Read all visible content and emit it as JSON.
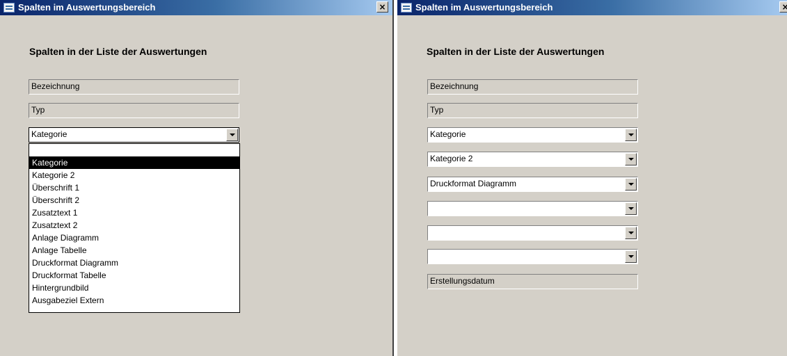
{
  "left_window": {
    "title": "Spalten im Auswertungsbereich",
    "close_label": "×",
    "heading": "Spalten in der Liste der Auswertungen",
    "field_bezeichnung": "Bezeichnung",
    "field_typ": "Typ",
    "combo_value": "Kategorie",
    "dropdown_options": [
      "Kategorie",
      "Kategorie 2",
      "Überschrift 1",
      "Überschrift 2",
      "Zusatztext 1",
      "Zusatztext 2",
      "Anlage Diagramm",
      "Anlage Tabelle",
      "Druckformat Diagramm",
      "Druckformat Tabelle",
      "Hintergrundbild",
      "Ausgabeziel Extern"
    ],
    "selected_option": "Kategorie"
  },
  "right_window": {
    "title": "Spalten im Auswertungsbereich",
    "close_label": "×",
    "heading": "Spalten in der Liste der Auswertungen",
    "field_bezeichnung": "Bezeichnung",
    "field_typ": "Typ",
    "combos": [
      "Kategorie",
      "Kategorie 2",
      "Druckformat Diagramm",
      "",
      "",
      ""
    ],
    "field_erstellungsdatum": "Erstellungsdatum"
  }
}
